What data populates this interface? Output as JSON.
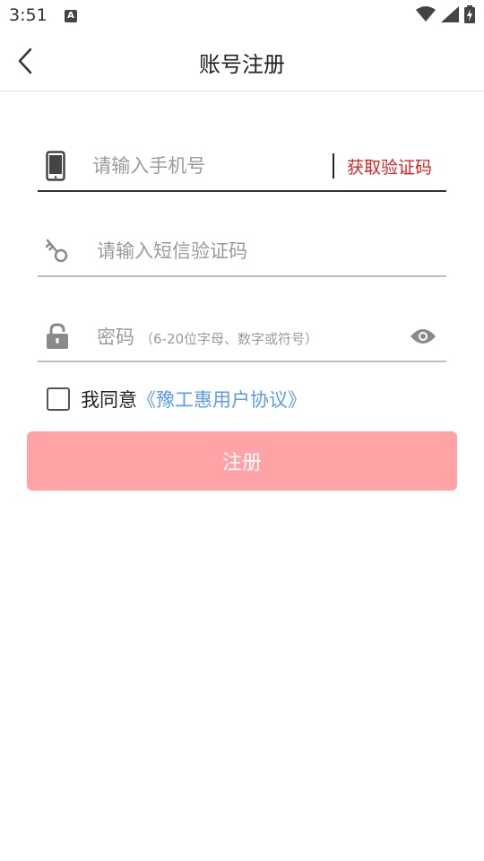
{
  "status_bar": {
    "time": "3:51",
    "notification_glyph": "A",
    "icons": [
      "wifi-icon",
      "signal-icon",
      "battery-charging-icon"
    ]
  },
  "header": {
    "title": "账号注册",
    "back_icon": "chevron-left-icon"
  },
  "form": {
    "phone": {
      "icon": "phone-icon",
      "placeholder": "请输入手机号",
      "value": "",
      "get_code_label": "获取验证码"
    },
    "sms_code": {
      "icon": "key-icon",
      "placeholder": "请输入短信验证码",
      "value": ""
    },
    "password": {
      "icon": "lock-icon",
      "placeholder_main": "密码",
      "placeholder_hint": "（6-20位字母、数字或符号）",
      "value": "",
      "toggle_icon": "eye-icon"
    }
  },
  "agreement": {
    "checked": false,
    "text": "我同意",
    "link_label": "《豫工惠用户协议》"
  },
  "register_button": {
    "label": "注册",
    "color": "#ffa3a6"
  },
  "colors": {
    "accent_red": "#e02020",
    "link_blue": "#5b9bea"
  }
}
